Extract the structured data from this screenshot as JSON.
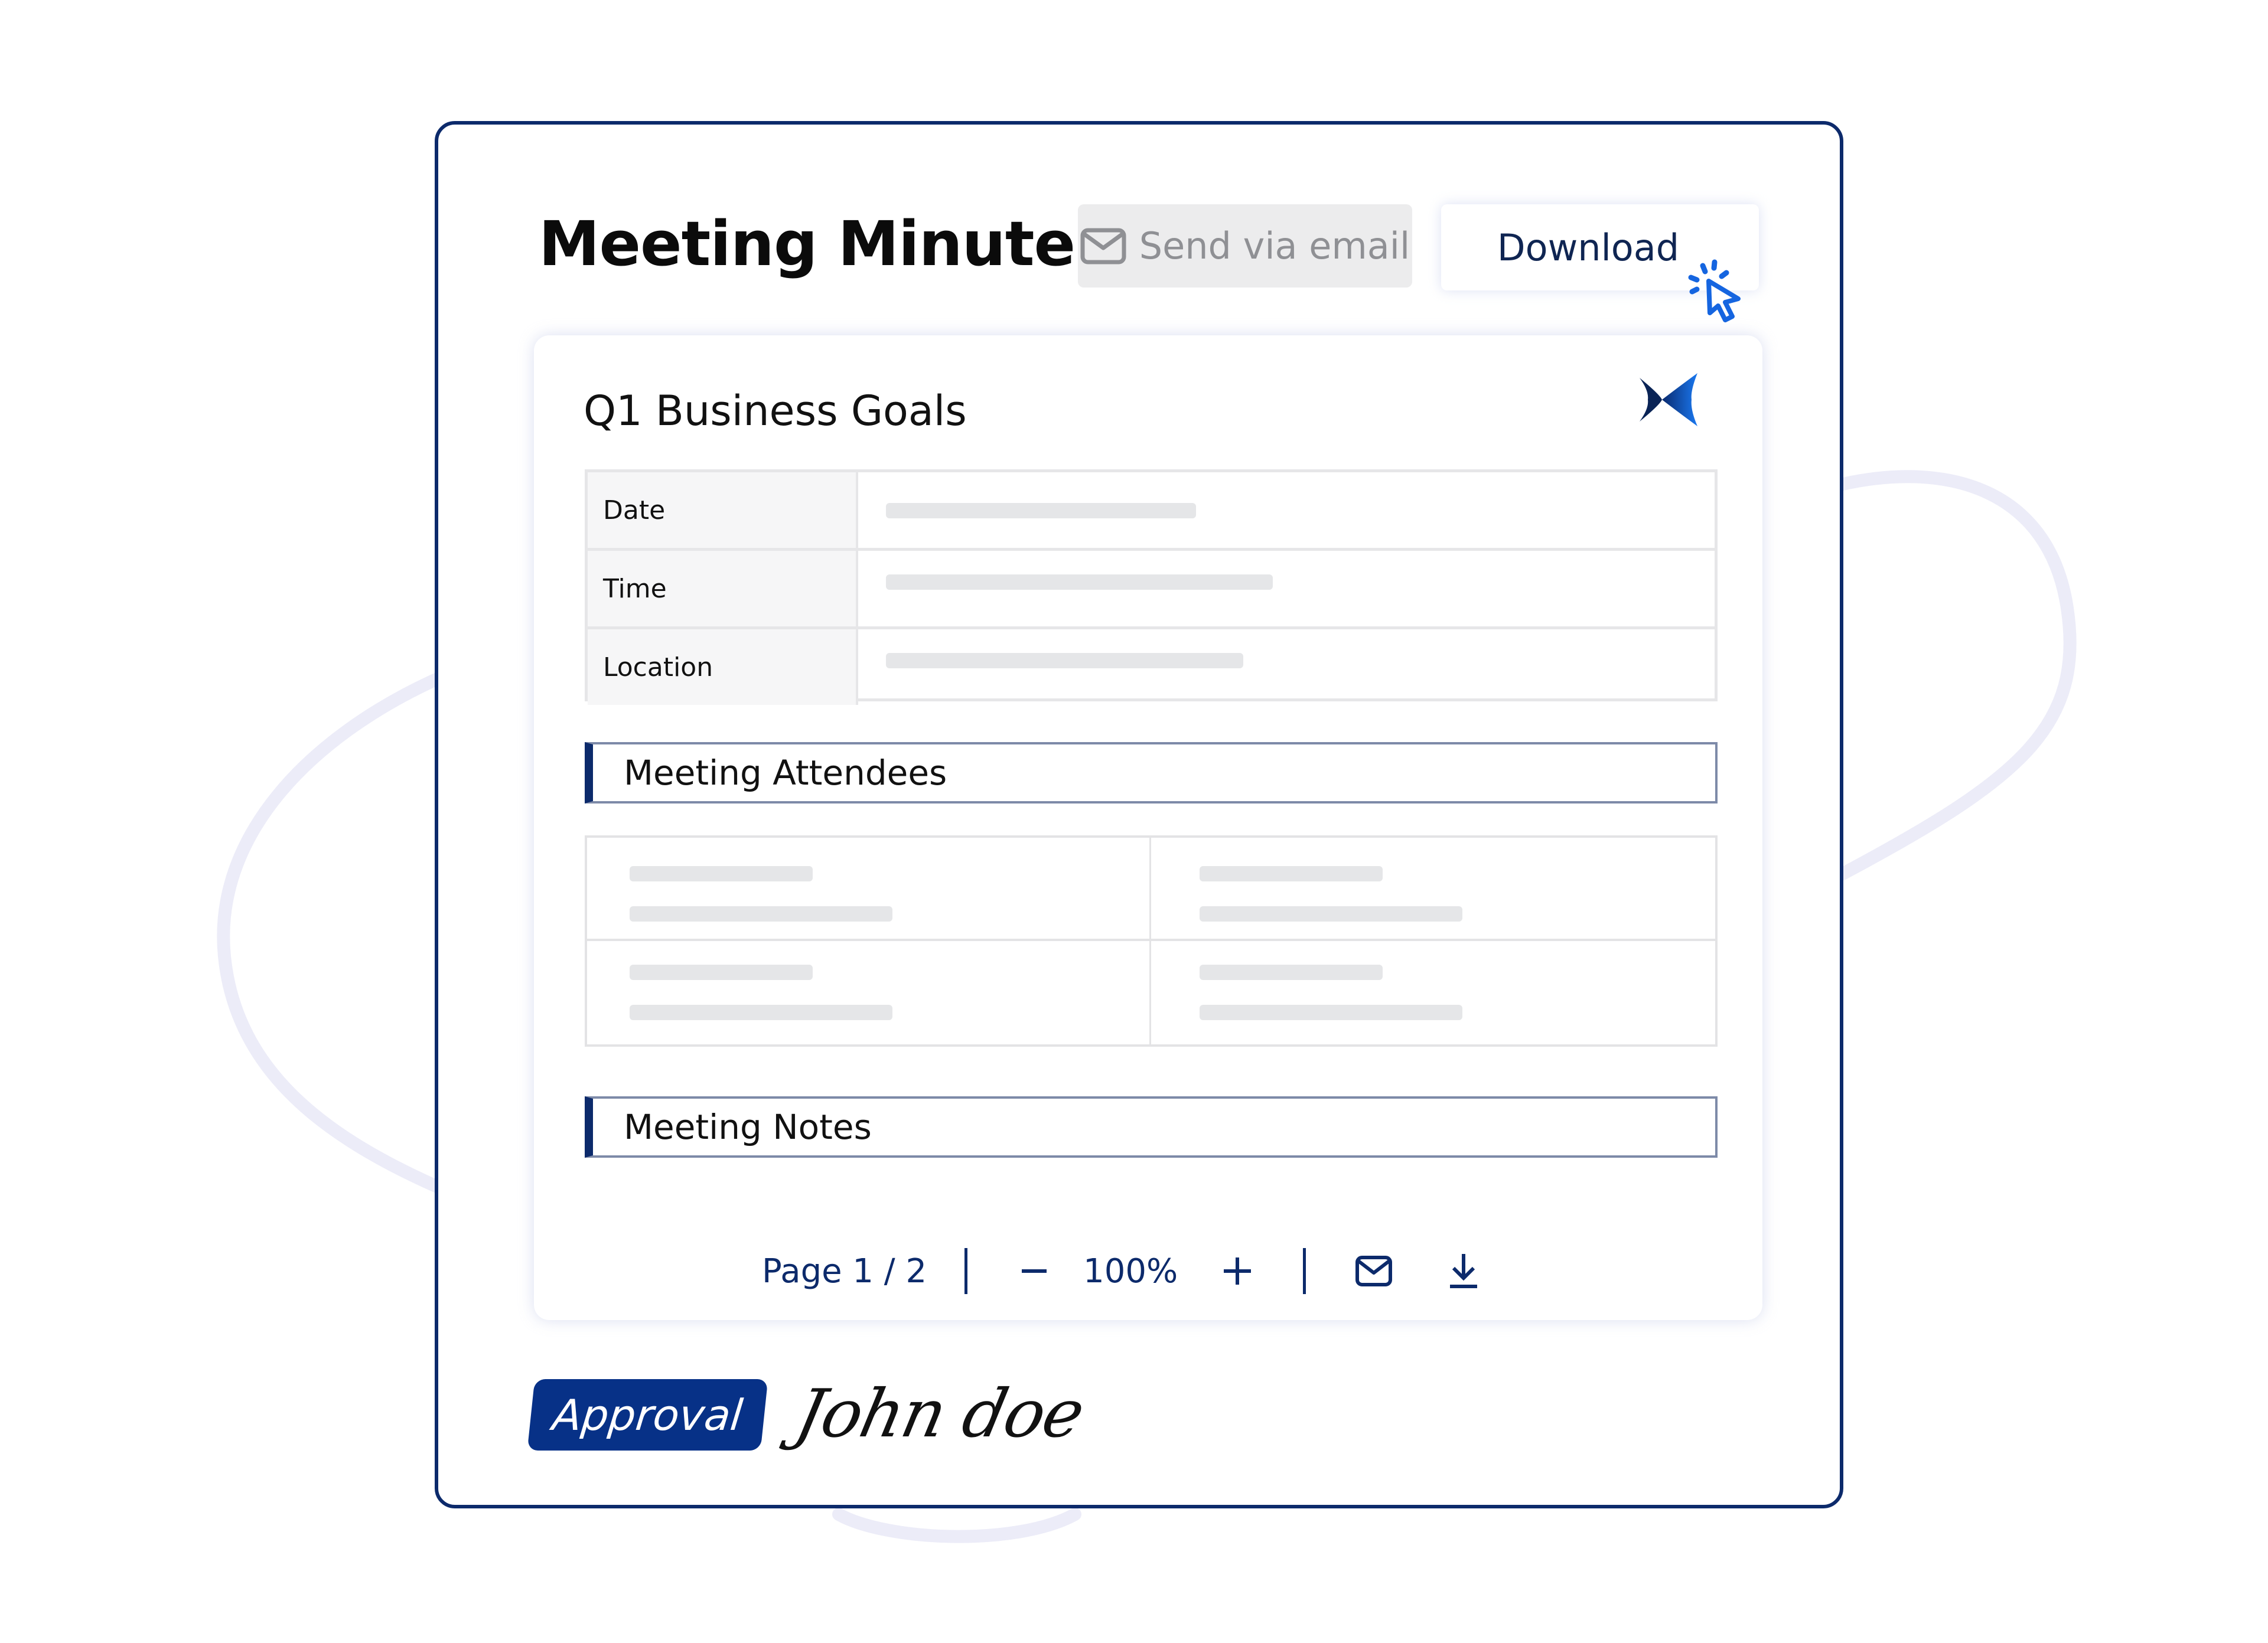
{
  "header": {
    "title": "Meeting Minutes",
    "send_email_label": "Send via email",
    "download_label": "Download",
    "send_email_icon": "envelope-icon",
    "cursor_icon": "click-cursor-icon"
  },
  "document": {
    "title": "Q1 Business Goals",
    "logo_icon": "brand-logo-icon",
    "info_rows": [
      {
        "label": "Date",
        "value": ""
      },
      {
        "label": "Time",
        "value": ""
      },
      {
        "label": "Location",
        "value": ""
      }
    ],
    "sections": {
      "attendees_label": "Meeting Attendees",
      "notes_label": "Meeting Notes"
    },
    "attendees": [
      {
        "name": "",
        "role": ""
      },
      {
        "name": "",
        "role": ""
      },
      {
        "name": "",
        "role": ""
      },
      {
        "name": "",
        "role": ""
      }
    ]
  },
  "toolbar": {
    "page_label": "Page 1 / 2",
    "current_page": 1,
    "total_pages": 2,
    "zoom_out_icon": "minus-icon",
    "zoom_level": "100%",
    "zoom_in_icon": "plus-icon",
    "email_icon": "envelope-icon",
    "download_icon": "download-icon"
  },
  "footer": {
    "approval_label": "Approval",
    "signature": "John doe"
  },
  "colors": {
    "brand_navy": "#0c2a6b",
    "accent_blue": "#1565e0",
    "approval_bg": "#073187",
    "skeleton": "#e5e6e8"
  }
}
